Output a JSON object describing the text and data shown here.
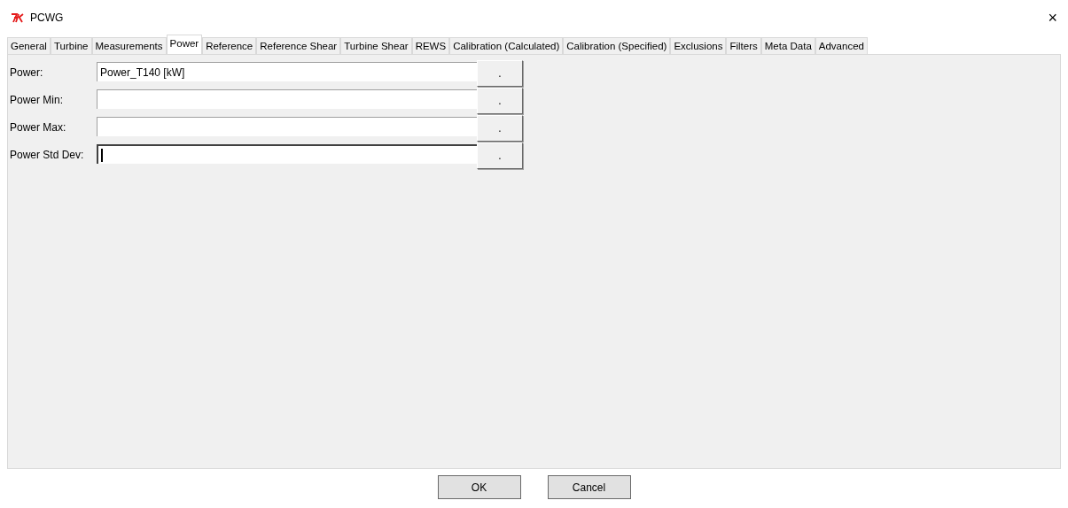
{
  "window": {
    "title": "PCWG",
    "close": "×"
  },
  "tabs": [
    {
      "label": "General",
      "selected": false
    },
    {
      "label": "Turbine",
      "selected": false
    },
    {
      "label": "Measurements",
      "selected": false
    },
    {
      "label": "Power",
      "selected": true
    },
    {
      "label": "Reference",
      "selected": false
    },
    {
      "label": "Reference Shear",
      "selected": false
    },
    {
      "label": "Turbine Shear",
      "selected": false
    },
    {
      "label": "REWS",
      "selected": false
    },
    {
      "label": "Calibration (Calculated)",
      "selected": false
    },
    {
      "label": "Calibration (Specified)",
      "selected": false
    },
    {
      "label": "Exclusions",
      "selected": false
    },
    {
      "label": "Filters",
      "selected": false
    },
    {
      "label": "Meta Data",
      "selected": false
    },
    {
      "label": "Advanced",
      "selected": false
    }
  ],
  "fields": [
    {
      "label": "Power:",
      "value": "Power_T140 [kW]",
      "button": ".",
      "focused": false
    },
    {
      "label": "Power Min:",
      "button": ".",
      "focused": false
    },
    {
      "label": "Power Max:",
      "button": ".",
      "focused": false
    },
    {
      "label": "Power Std Dev:",
      "button": ".",
      "focused": true
    }
  ],
  "buttons": [
    "OK",
    "Cancel"
  ]
}
